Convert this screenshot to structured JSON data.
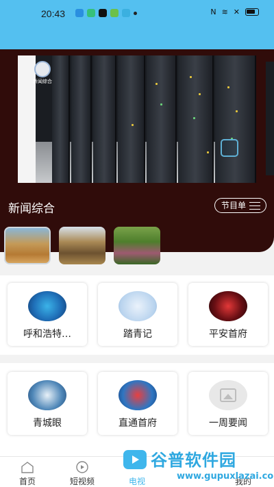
{
  "status_bar": {
    "time": "20:43",
    "right_text": "N"
  },
  "player": {
    "station_text": "新闻综合",
    "channel_title": "新闻综合",
    "program_button_label": "节目单"
  },
  "programs_row1": [
    {
      "label": "呼和浩特…",
      "logo": "hohhot-news-logo"
    },
    {
      "label": "踏青记",
      "logo": "taqingji-logo"
    },
    {
      "label": "平安首府",
      "logo": "pingan-logo"
    }
  ],
  "programs_row2": [
    {
      "label": "青城眼",
      "logo": "qingchengyan-logo"
    },
    {
      "label": "直通首府",
      "logo": "zhitong-logo"
    },
    {
      "label": "一周要闻",
      "logo": "placeholder-image-icon"
    }
  ],
  "bottom_nav": {
    "home": "首页",
    "short_video": "短视频",
    "tv": "电视",
    "fourth": "我的"
  },
  "watermark": {
    "title": "谷普软件园",
    "url": "www.gupuxlazai.com"
  },
  "colors": {
    "status_bar_bg": "#54c0f0",
    "panel_bg": "#300c0a",
    "accent": "#3fb6ec"
  }
}
